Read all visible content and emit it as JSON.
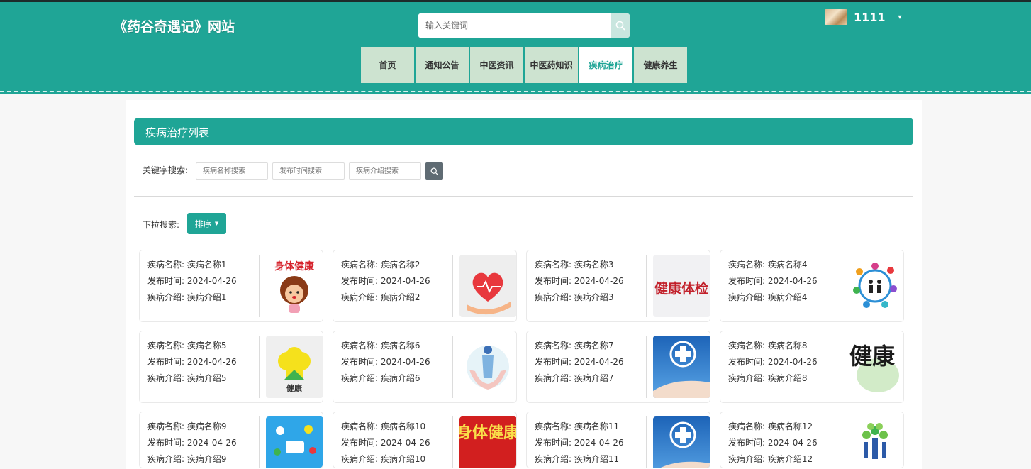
{
  "header": {
    "site_title": "《药谷奇遇记》网站",
    "search_placeholder": "输入关键词",
    "username": "1111",
    "caret": "▾",
    "accent_color": "#1fa596"
  },
  "nav": {
    "items": [
      {
        "label": "首页",
        "active": false
      },
      {
        "label": "通知公告",
        "active": false
      },
      {
        "label": "中医资讯",
        "active": false
      },
      {
        "label": "中医药知识",
        "active": false
      },
      {
        "label": "疾病治疗",
        "active": true
      },
      {
        "label": "健康养生",
        "active": false
      }
    ]
  },
  "page": {
    "title": "疾病治疗列表",
    "keyword_label": "关键字搜索:",
    "name_placeholder": "疾病名称搜索",
    "time_placeholder": "发布时间搜索",
    "intro_placeholder": "疾病介绍搜索",
    "dropdown_label": "下拉搜索:",
    "sort_label": "排序"
  },
  "cards": [
    {
      "name": "疾病名称: 疾病名称1",
      "time": "发布时间: 2024-04-26",
      "intro": "疾病介绍: 疾病介绍1",
      "image_text": "身体健康",
      "image_icon": "cartoon-girl-icon"
    },
    {
      "name": "疾病名称: 疾病名称2",
      "time": "发布时间: 2024-04-26",
      "intro": "疾病介绍: 疾病介绍2",
      "image_text": "",
      "image_icon": "heart-hand-icon"
    },
    {
      "name": "疾病名称: 疾病名称3",
      "time": "发布时间: 2024-04-26",
      "intro": "疾病介绍: 疾病介绍3",
      "image_text": "健康体检",
      "image_icon": "calligraphy-icon"
    },
    {
      "name": "疾病名称: 疾病名称4",
      "time": "发布时间: 2024-04-26",
      "intro": "疾病介绍: 疾病介绍4",
      "image_text": "",
      "image_icon": "family-circle-icon"
    },
    {
      "name": "疾病名称: 疾病名称5",
      "time": "发布时间: 2024-04-26",
      "intro": "疾病介绍: 疾病介绍5",
      "image_text": "健康",
      "image_icon": "flower-icon"
    },
    {
      "name": "疾病名称: 疾病名称6",
      "time": "发布时间: 2024-04-26",
      "intro": "疾病介绍: 疾病介绍6",
      "image_text": "",
      "image_icon": "hands-body-icon"
    },
    {
      "name": "疾病名称: 疾病名称7",
      "time": "发布时间: 2024-04-26",
      "intro": "疾病介绍: 疾病介绍7",
      "image_text": "",
      "image_icon": "medical-cross-icon"
    },
    {
      "name": "疾病名称: 疾病名称8",
      "time": "发布时间: 2024-04-26",
      "intro": "疾病介绍: 疾病介绍8",
      "image_text": "健康",
      "image_icon": "brush-calligraphy-icon"
    },
    {
      "name": "疾病名称: 疾病名称9",
      "time": "发布时间: 2024-04-26",
      "intro": "疾病介绍: 疾病介绍9",
      "image_text": "",
      "image_icon": "health-apps-icon"
    },
    {
      "name": "疾病名称: 疾病名称10",
      "time": "发布时间: 2024-04-26",
      "intro": "疾病介绍: 疾病介绍10",
      "image_text": "身体健康",
      "image_icon": "red-poster-icon"
    },
    {
      "name": "疾病名称: 疾病名称11",
      "time": "发布时间: 2024-04-26",
      "intro": "疾病介绍: 疾病介绍11",
      "image_text": "",
      "image_icon": "medical-cross-icon"
    },
    {
      "name": "疾病名称: 疾病名称12",
      "time": "发布时间: 2024-04-26",
      "intro": "疾病介绍: 疾病介绍12",
      "image_text": "",
      "image_icon": "people-tree-icon"
    }
  ]
}
